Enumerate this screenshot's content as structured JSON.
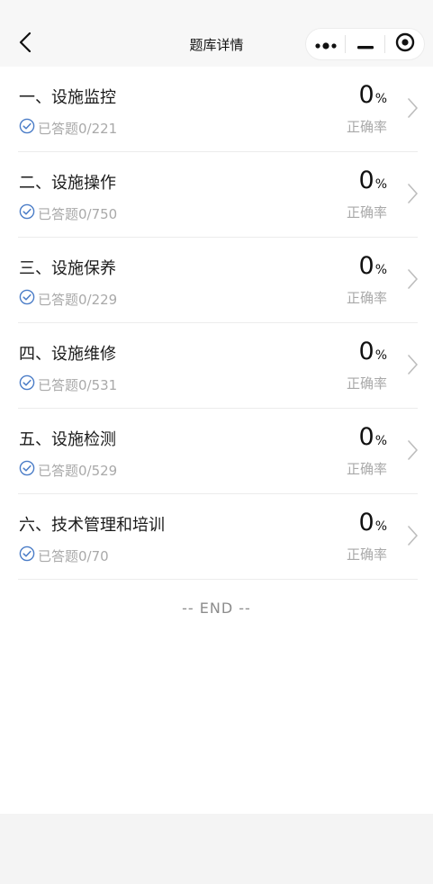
{
  "header": {
    "title": "题库详情",
    "back_icon": "chevron-left-icon",
    "capsule_icons": [
      "more-dots-icon",
      "minimize-icon",
      "close-target-icon"
    ]
  },
  "categories": [
    {
      "title": "一、设施监控",
      "answered": "已答题0/221",
      "percent": "0",
      "unit": "%",
      "rate_label": "正确率"
    },
    {
      "title": "二、设施操作",
      "answered": "已答题0/750",
      "percent": "0",
      "unit": "%",
      "rate_label": "正确率"
    },
    {
      "title": "三、设施保养",
      "answered": "已答题0/229",
      "percent": "0",
      "unit": "%",
      "rate_label": "正确率"
    },
    {
      "title": "四、设施维修",
      "answered": "已答题0/531",
      "percent": "0",
      "unit": "%",
      "rate_label": "正确率"
    },
    {
      "title": "五、设施检测",
      "answered": "已答题0/529",
      "percent": "0",
      "unit": "%",
      "rate_label": "正确率"
    },
    {
      "title": "六、技术管理和培训",
      "answered": "已答题0/70",
      "percent": "0",
      "unit": "%",
      "rate_label": "正确率"
    }
  ],
  "end_text": "-- END --",
  "colors": {
    "check_icon": "#4a7cc7",
    "muted_text": "#a9a9a9",
    "chevron": "#bdbdbd"
  }
}
